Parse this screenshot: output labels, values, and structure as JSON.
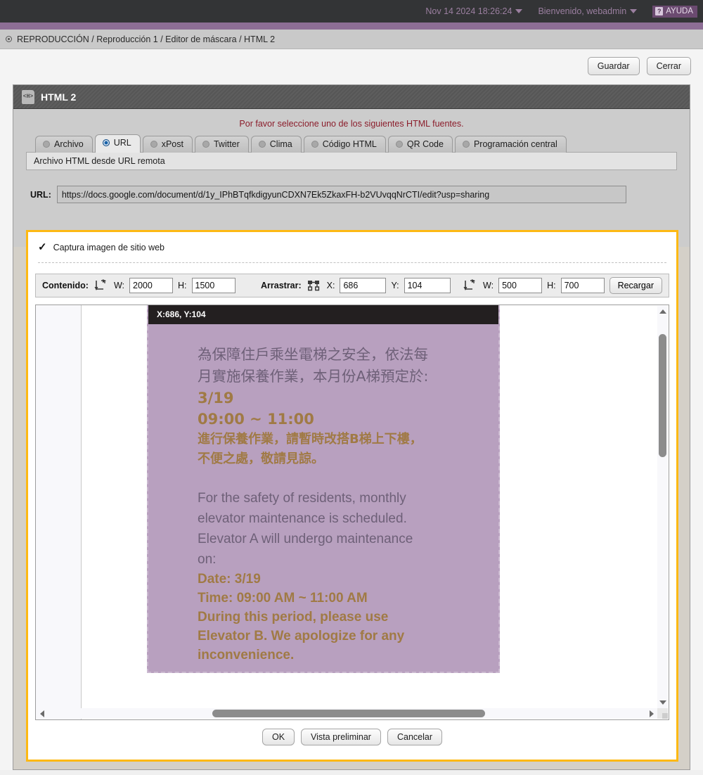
{
  "topbar": {
    "datetime": "Nov 14 2024 18:26:24",
    "welcome": "Bienvenido, webadmin",
    "help_label": "AYUDA",
    "help_icon_glyph": "?"
  },
  "breadcrumb": {
    "text": "REPRODUCCIÓN / Reproducción 1 / Editor de máscara / HTML 2"
  },
  "actionbar": {
    "save_label": "Guardar",
    "close_label": "Cerrar"
  },
  "dialog": {
    "title": "HTML 2",
    "title_icon": "<H>",
    "hint": "Por favor seleccione uno de los siguientes HTML fuentes.",
    "tabs": [
      {
        "label": "Archivo",
        "active": false
      },
      {
        "label": "URL",
        "active": true
      },
      {
        "label": "xPost",
        "active": false
      },
      {
        "label": "Twitter",
        "active": false
      },
      {
        "label": "Clima",
        "active": false
      },
      {
        "label": "Código HTML",
        "active": false
      },
      {
        "label": "QR Code",
        "active": false
      },
      {
        "label": "Programación central",
        "active": false
      }
    ],
    "panel_header": "Archivo HTML desde URL remota",
    "url_label": "URL:",
    "url_value": "https://docs.google.com/document/d/1y_IPhBTqfkdigyunCDXN7Ek5ZkaxFH-b2VUvqqNrCTI/edit?usp=sharing"
  },
  "capture": {
    "checkbox_label": "Captura imagen de sitio web",
    "checkbox_checked": true,
    "content_label": "Contenido:",
    "content_w_label": "W:",
    "content_w_value": "2000",
    "content_h_label": "H:",
    "content_h_value": "1500",
    "drag_label": "Arrastrar:",
    "drag_x_label": "X:",
    "drag_x_value": "686",
    "drag_y_label": "Y:",
    "drag_y_value": "104",
    "crop_w_label": "W:",
    "crop_w_value": "500",
    "crop_h_label": "H:",
    "crop_h_value": "700",
    "reload_label": "Recargar",
    "highlight_color": "#fdb913",
    "buttons": {
      "ok": "OK",
      "preview": "Vista preliminar",
      "cancel": "Cancelar"
    }
  },
  "preview": {
    "coord_badge": "X:686, Y:104",
    "background_color": "#b8a0bf",
    "text_color": "#6e6078",
    "accent_color": "#a07a45",
    "chinese_lines": [
      "為保障住戶乘坐電梯之安全，依法每",
      "月實施保養作業，本月份A梯預定於:"
    ],
    "date_cn": "3/19",
    "time_cn": "09:00 ~ 11:00",
    "chinese_notice": [
      "進行保養作業，請暫時改搭B梯上下樓，",
      "不便之處，敬請見諒。"
    ],
    "english_lines": [
      "For the safety of residents, monthly",
      "elevator maintenance is scheduled.",
      "Elevator A will undergo maintenance",
      "on:"
    ],
    "date_en": "Date: 3/19",
    "time_en": "Time: 09:00 AM ~ 11:00 AM",
    "english_notice": [
      "During this period, please use",
      "Elevator B. We apologize for any",
      "inconvenience."
    ]
  }
}
